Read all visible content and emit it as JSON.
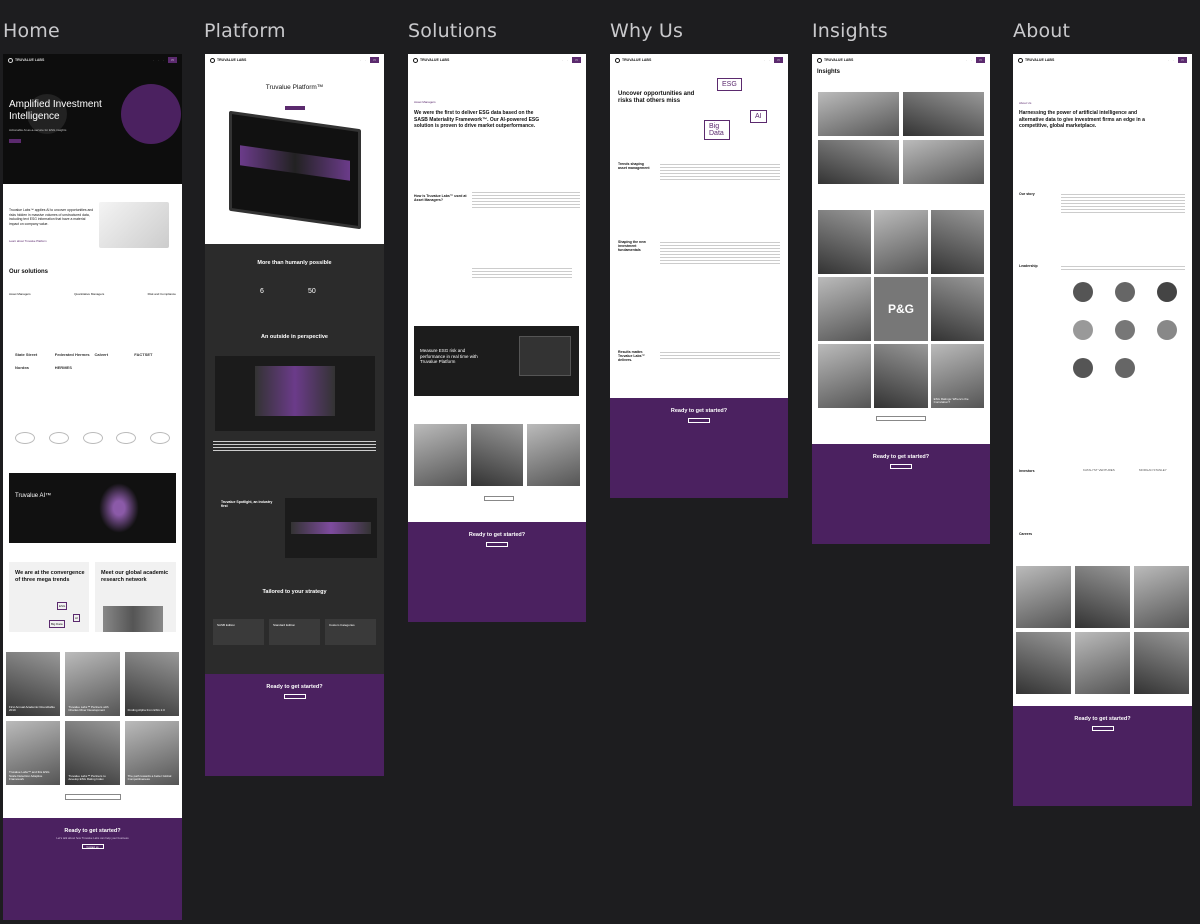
{
  "columns": [
    "Home",
    "Platform",
    "Solutions",
    "Why Us",
    "Insights",
    "About"
  ],
  "brand": "TRUVALUE LABS",
  "home": {
    "hero_title": "Amplified Investment Intelligence",
    "hero_sub": "Actionable AI-as-a-service for ESG insights",
    "about_title": "Truvalue Labs™ applies AI to uncover opportunities and risks hidden in massive volumes of unstructured data, including text ESG information that have a material impact on company value.",
    "about_link": "Learn about Truvalue Platform",
    "solutions_title": "Our solutions",
    "solutions": [
      "Asset Managers",
      "Quantitative Managers",
      "Risk and Compliance"
    ],
    "logos": [
      "State Street",
      "Federated Hermes",
      "Calvert",
      "FACTSET",
      "Nordea",
      "HERMES"
    ],
    "ai_title": "Truvalue AI™",
    "trends_title": "We are at the convergence of three mega trends",
    "trends_tags": [
      "ESG",
      "AI",
      "Big Data"
    ],
    "academic_title": "Meet our global academic research network",
    "news": [
      "First Annual Academic Roundtable 2019",
      "Truvalue Labs™ Partners with Charles River Development",
      "Finding Alpha from ESG 2.0",
      "Truvalue Labs™ and Ibis ESG Scale Detection Adaptive Framework",
      "Truvalue Labs™ Partners to develop ESG Rating Index",
      "The path towards a better Global Competitiveness"
    ],
    "cta_title": "Ready to get started?",
    "cta_sub": "Let's talk about how Truvalue Labs can help your business",
    "cta_btn": "Contact us"
  },
  "platform": {
    "hero_title": "Truvalue Platform™",
    "stats_title": "More than humanly possible",
    "stat_values": [
      "6",
      "50"
    ],
    "outsider_title": "An outside in perspective",
    "spotlight_title": "Truvalue Spotlight, an industry first",
    "tailored_title": "Tailored to your strategy",
    "editions": [
      "SASB Edition",
      "Standard Edition",
      "Custom Categories"
    ],
    "cta_title": "Ready to get started?"
  },
  "solutions": {
    "tag": "Asset Managers",
    "hero_title": "We were the first to deliver ESG data based on the SASB Materiality Framework™. Our AI-powered ESG solution is proven to drive market outperformance.",
    "question": "How is Truvalue Labs™ used at Asset Managers?",
    "banner_title": "Measure ESG risk and performance in real time with Truvalue Platform",
    "cta_title": "Ready to get started?"
  },
  "whyus": {
    "hero_title": "Uncover opportunities and risks that others miss",
    "tags": [
      "ESG",
      "AI",
      "Big Data"
    ],
    "sections": [
      "Trends shaping asset management",
      "Shaping the new investment fundamentals",
      "Results matter. Truvalue Labs™ delivers."
    ],
    "cta_title": "Ready to get started?"
  },
  "insights": {
    "title": "Insights",
    "tiles": [
      "P&G",
      "ESG Ratings: Where's the Correlation?"
    ],
    "cta_title": "Ready to get started?"
  },
  "about": {
    "tag": "About Us",
    "hero_title": "Harnessing the power of artificial intelligence and alternative data to give investment firms an edge in a competitive, global marketplace.",
    "sections": [
      "Our story",
      "Leadership",
      "Investors",
      "Careers"
    ],
    "investors": [
      "KATALYST VENTURES",
      "MORGAN STANLEY"
    ],
    "cta_title": "Ready to get started?"
  },
  "colors": {
    "purple": "#4b2160",
    "bg": "#1d1d1f"
  }
}
